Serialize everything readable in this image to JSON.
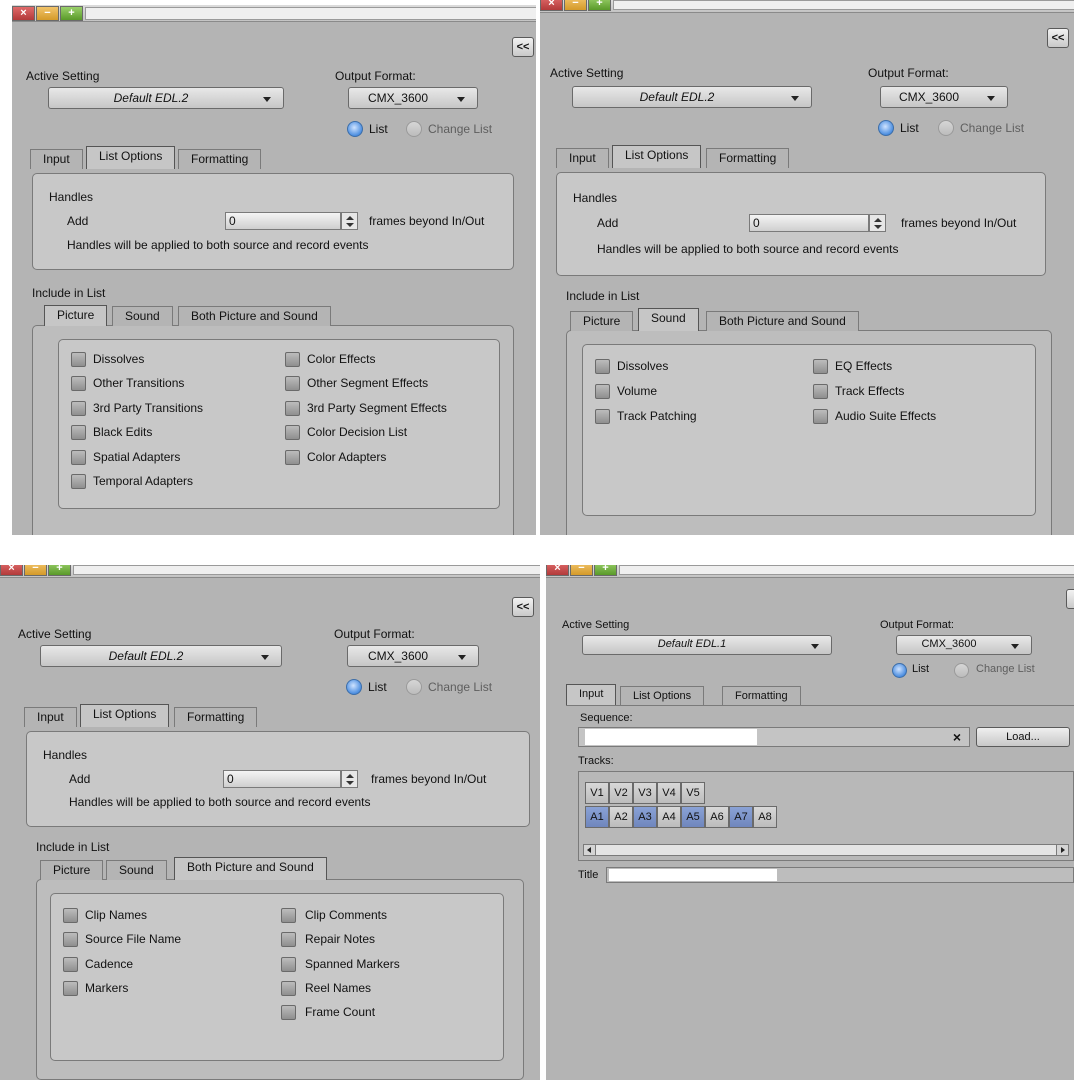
{
  "common": {
    "collapse_label": "<<",
    "active_setting_label": "Active Setting",
    "output_format_label": "Output Format:",
    "output_format_value": "CMX_3600",
    "radio_list": "List",
    "radio_change_list": "Change List",
    "tabs": [
      "Input",
      "List Options",
      "Formatting"
    ],
    "handles_title": "Handles",
    "add_label": "Add",
    "add_value": "0",
    "frames_label": "frames beyond In/Out",
    "handles_note": "Handles will be applied to both source and record events",
    "include_label": "Include in List",
    "subtabs": [
      "Picture",
      "Sound",
      "Both Picture and Sound"
    ]
  },
  "panel_picture": {
    "active_setting_value": "Default EDL.2",
    "left_items": [
      "Dissolves",
      "Other Transitions",
      "3rd Party Transitions",
      "Black Edits",
      "Spatial Adapters",
      "Temporal Adapters"
    ],
    "right_items": [
      "Color Effects",
      "Other Segment Effects",
      "3rd Party Segment Effects",
      "Color Decision List",
      "Color Adapters"
    ]
  },
  "panel_sound": {
    "active_setting_value": "Default EDL.2",
    "left_items": [
      "Dissolves",
      "Volume",
      "Track Patching"
    ],
    "right_items": [
      "EQ Effects",
      "Track Effects",
      "Audio Suite Effects"
    ]
  },
  "panel_both": {
    "active_setting_value": "Default EDL.2",
    "left_items": [
      "Clip Names",
      "Source File Name",
      "Cadence",
      "Markers"
    ],
    "right_items": [
      "Clip Comments",
      "Repair Notes",
      "Spanned Markers",
      "Reel Names",
      "Frame Count"
    ]
  },
  "panel_input": {
    "active_setting_value": "Default EDL.1",
    "sequence_label": "Sequence:",
    "clear_label": "×",
    "load_label": "Load...",
    "tracks_label": "Tracks:",
    "video_tracks": [
      "V1",
      "V2",
      "V3",
      "V4",
      "V5"
    ],
    "audio_tracks": [
      "A1",
      "A2",
      "A3",
      "A4",
      "A5",
      "A6",
      "A7",
      "A8"
    ],
    "title_label": "Title"
  },
  "window_buttons": {
    "close": "×",
    "minimize": "−",
    "maximize": "+"
  }
}
